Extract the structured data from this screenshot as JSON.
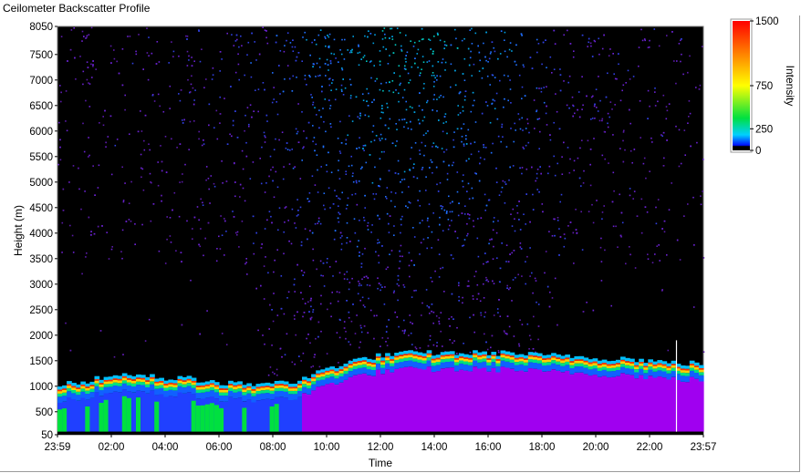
{
  "window": {
    "title": "Ceilometer Backscatter Profile"
  },
  "chart_data": {
    "type": "heatmap",
    "title": "Ceilometer Backscatter Profile",
    "xlabel": "Time",
    "ylabel": "Height (m)",
    "x_ticks": [
      "23:59",
      "02:00",
      "04:00",
      "06:00",
      "08:00",
      "10:00",
      "12:00",
      "14:00",
      "16:00",
      "18:00",
      "20:00",
      "22:00",
      "23:57"
    ],
    "y_ticks": [
      50,
      500,
      1000,
      1500,
      2000,
      2500,
      3000,
      3500,
      4000,
      4500,
      5000,
      5500,
      6000,
      6500,
      7000,
      7500,
      8050
    ],
    "ylim": [
      50,
      8050
    ],
    "colorbar": {
      "label": "Intensity",
      "ticks": [
        0,
        250,
        750,
        1500
      ],
      "range": [
        0,
        1500
      ],
      "colors": [
        "#000000",
        "#0020ff",
        "#00e5ff",
        "#00e040",
        "#ffff00",
        "#ff8000",
        "#ff0000"
      ]
    },
    "layer_top_height_by_hour": [
      {
        "hour": 0,
        "height": 850
      },
      {
        "hour": 1,
        "height": 900
      },
      {
        "hour": 2,
        "height": 1000
      },
      {
        "hour": 3,
        "height": 1050
      },
      {
        "hour": 4,
        "height": 950
      },
      {
        "hour": 5,
        "height": 950
      },
      {
        "hour": 6,
        "height": 850
      },
      {
        "hour": 7,
        "height": 850
      },
      {
        "hour": 8,
        "height": 850
      },
      {
        "hour": 9,
        "height": 900
      },
      {
        "hour": 10,
        "height": 1150
      },
      {
        "hour": 11,
        "height": 1300
      },
      {
        "hour": 12,
        "height": 1400
      },
      {
        "hour": 13,
        "height": 1450
      },
      {
        "hour": 14,
        "height": 1450
      },
      {
        "hour": 15,
        "height": 1450
      },
      {
        "hour": 16,
        "height": 1450
      },
      {
        "hour": 17,
        "height": 1450
      },
      {
        "hour": 18,
        "height": 1400
      },
      {
        "hour": 19,
        "height": 1400
      },
      {
        "hour": 20,
        "height": 1350
      },
      {
        "hour": 21,
        "height": 1350
      },
      {
        "hour": 22,
        "height": 1300
      },
      {
        "hour": 23,
        "height": 1250
      }
    ],
    "spike": {
      "time": "22:30",
      "height": 1900
    },
    "grid": false
  }
}
